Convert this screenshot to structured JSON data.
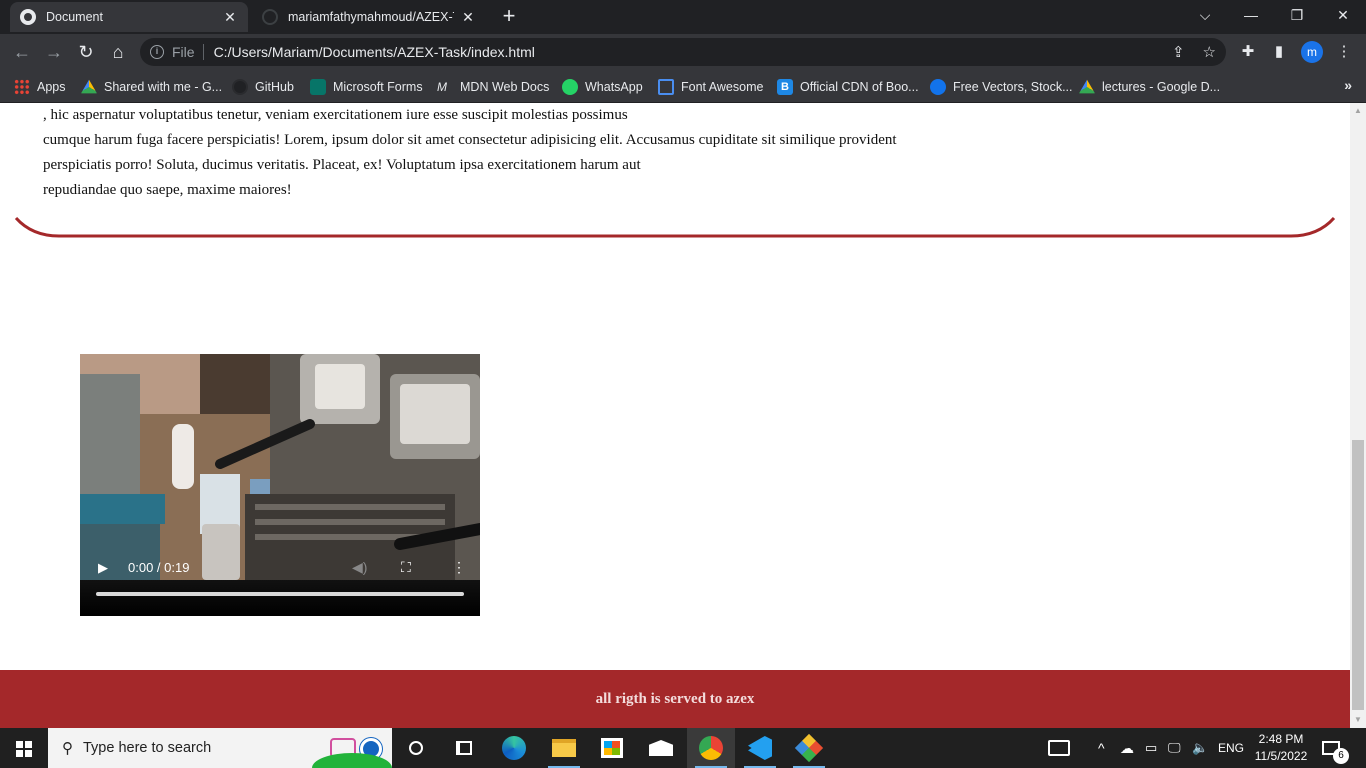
{
  "browser": {
    "tabs": [
      {
        "title": "Document",
        "active": true
      },
      {
        "title": "mariamfathymahmoud/AZEX-Tas",
        "active": false
      }
    ],
    "new_tab_label": "+",
    "address": {
      "scheme_label": "File",
      "url": "C:/Users/Mariam/Documents/AZEX-Task/index.html"
    },
    "profile_initial": "m",
    "bookmarks": [
      {
        "label": "Apps",
        "icon": "apps-grid-icon"
      },
      {
        "label": "Shared with me - G...",
        "icon": "google-drive-icon"
      },
      {
        "label": "GitHub",
        "icon": "github-icon"
      },
      {
        "label": "Microsoft Forms",
        "icon": "microsoft-forms-icon"
      },
      {
        "label": "MDN Web Docs",
        "icon": "mdn-icon"
      },
      {
        "label": "WhatsApp",
        "icon": "whatsapp-icon"
      },
      {
        "label": "Font Awesome",
        "icon": "font-awesome-flag-icon"
      },
      {
        "label": "Official CDN of Boo...",
        "icon": "bootstrap-icon"
      },
      {
        "label": "Free Vectors, Stock...",
        "icon": "freepik-icon"
      },
      {
        "label": "lectures - Google D...",
        "icon": "google-drive-icon"
      }
    ],
    "bookmarks_more": "»"
  },
  "page": {
    "paragraph_lines": [
      ", hic aspernatur voluptatibus tenetur, veniam exercitationem iure esse suscipit molestias possimus",
      "cumque harum fuga facere perspiciatis! Lorem, ipsum dolor sit amet consectetur adipisicing elit. Accusamus cupiditate sit similique provident",
      "perspiciatis porro! Soluta, ducimus veritatis. Placeat, ex! Voluptatum ipsa exercitationem harum aut",
      "repudiandae quo saepe, maxime maiores!"
    ],
    "video": {
      "time": "0:00 / 0:19",
      "progress": 0
    },
    "footer_text": "all rigth is served to azex",
    "accent_color": "#a4282a"
  },
  "taskbar": {
    "search_placeholder": "Type here to search",
    "language": "ENG",
    "time": "2:48 PM",
    "date": "11/5/2022",
    "notification_count": "6"
  }
}
